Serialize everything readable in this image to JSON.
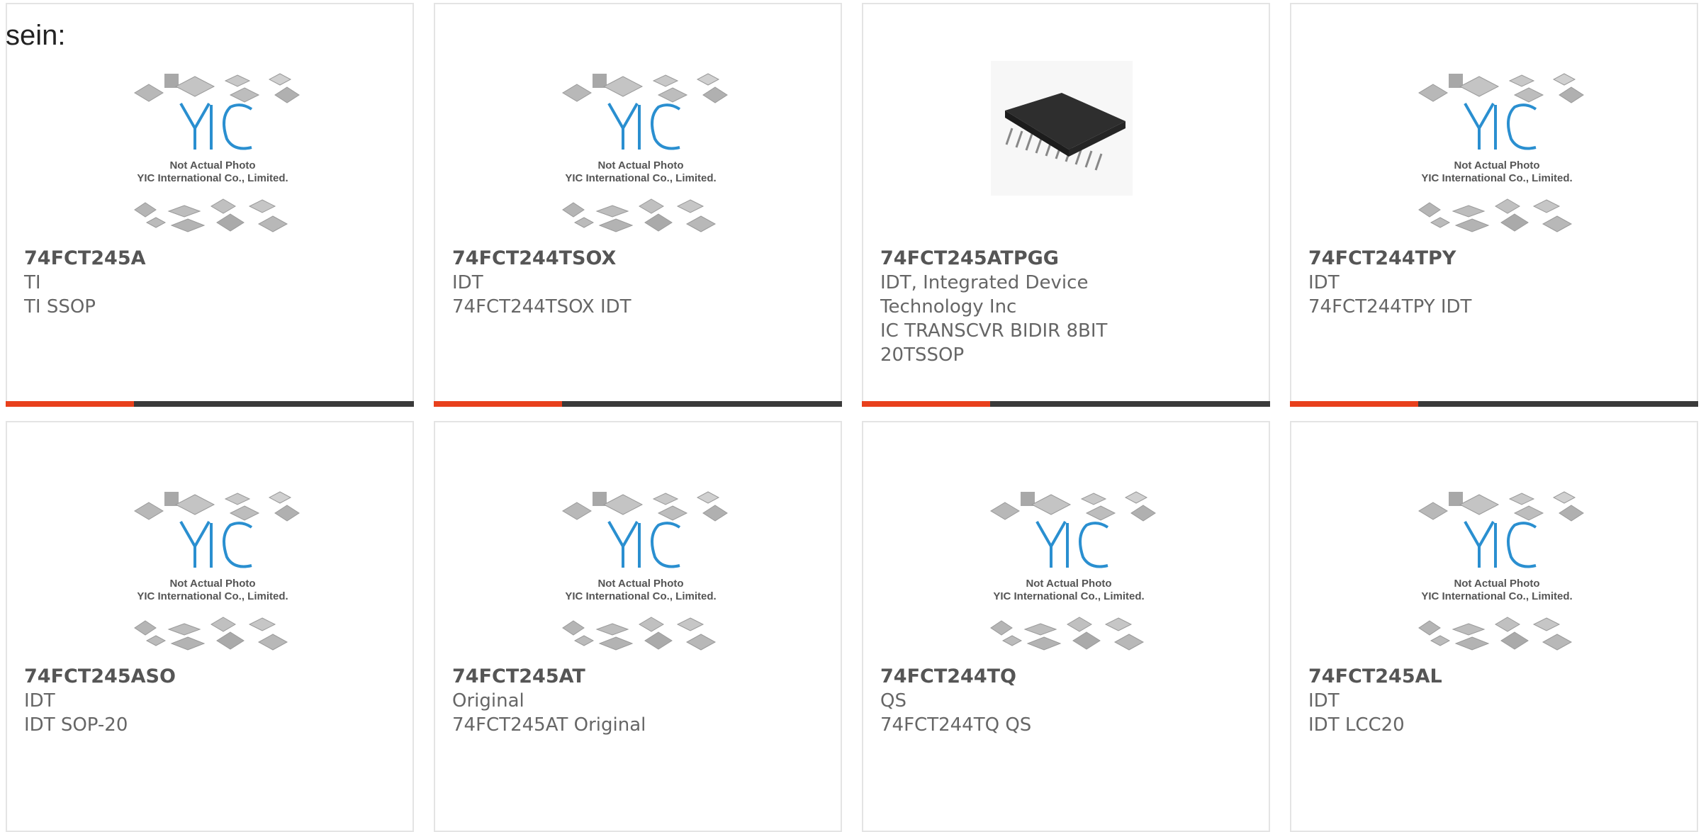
{
  "heading": "sein:",
  "placeholder_text": {
    "line1": "Not Actual Photo",
    "line2": "YIC International Co., Limited."
  },
  "colors": {
    "accent": "#e8401c",
    "bar_dark": "#3a3a3a",
    "logo_blue": "#2a8fd0"
  },
  "products": [
    {
      "part": "74FCT245A",
      "maker": "TI",
      "desc": "TI SSOP",
      "image": "yic-placeholder",
      "has_bar": true
    },
    {
      "part": "74FCT244TSOX",
      "maker": "IDT",
      "desc": "74FCT244TSOX IDT",
      "image": "yic-placeholder",
      "has_bar": true
    },
    {
      "part": "74FCT245ATPGG",
      "maker": "IDT, Integrated Device Technology Inc",
      "desc": "IC TRANSCVR BIDIR 8BIT 20TSSOP",
      "image": "tssop-chip",
      "has_bar": true
    },
    {
      "part": "74FCT244TPY",
      "maker": "IDT",
      "desc": "74FCT244TPY IDT",
      "image": "yic-placeholder",
      "has_bar": true
    },
    {
      "part": "74FCT245ASO",
      "maker": "IDT",
      "desc": "IDT SOP-20",
      "image": "yic-placeholder",
      "has_bar": false
    },
    {
      "part": "74FCT245AT",
      "maker": "Original",
      "desc": "74FCT245AT Original",
      "image": "yic-placeholder",
      "has_bar": false
    },
    {
      "part": "74FCT244TQ",
      "maker": "QS",
      "desc": "74FCT244TQ QS",
      "image": "yic-placeholder",
      "has_bar": false
    },
    {
      "part": "74FCT245AL",
      "maker": "IDT",
      "desc": "IDT LCC20",
      "image": "yic-placeholder",
      "has_bar": false
    }
  ]
}
